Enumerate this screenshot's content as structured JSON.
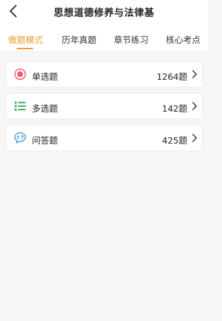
{
  "header": {
    "title": "思想道德修养与法律基"
  },
  "tabs": [
    {
      "label": "做题模式",
      "active": true
    },
    {
      "label": "历年真题",
      "active": false
    },
    {
      "label": "章节练习",
      "active": false
    },
    {
      "label": "核心考点",
      "active": false
    }
  ],
  "categories": [
    {
      "label": "单选题",
      "count": "1264题",
      "icon": "radio-target-icon",
      "icon_color": "#f15a6c"
    },
    {
      "label": "多选题",
      "count": "142题",
      "icon": "list-icon",
      "icon_color": "#3bb25a"
    },
    {
      "label": "问答题",
      "count": "425题",
      "icon": "question-bubble-icon",
      "icon_color": "#3a8ed8"
    }
  ],
  "colors": {
    "accent": "#f09a2a",
    "background": "#f6f6f6"
  }
}
